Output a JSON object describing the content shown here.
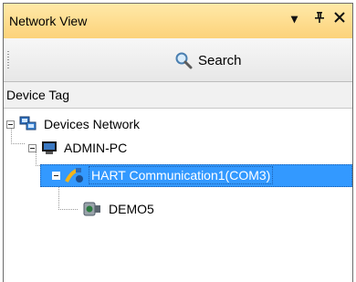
{
  "window": {
    "title": "Network View",
    "controls": {
      "dropdown_glyph": "▾",
      "pin_glyph": "ᛘ",
      "close_glyph": "✕"
    }
  },
  "toolbar": {
    "search_label": "Search"
  },
  "columns": {
    "device_tag": "Device Tag"
  },
  "tree": {
    "root": "Devices Network",
    "pc": "ADMIN-PC",
    "comm": "HART Communication1(COM3)",
    "device": "DEMO5"
  },
  "colors": {
    "title_bar": "#fcd27a",
    "selection": "#3399ff"
  }
}
